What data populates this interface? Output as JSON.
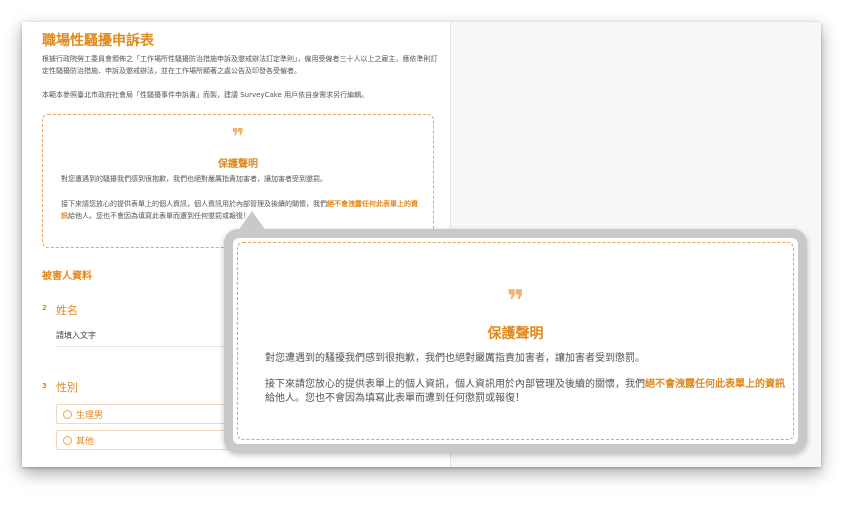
{
  "form": {
    "title": "職場性騷擾申訴表",
    "intro_1": "根據行政院勞工委員會頒佈之「工作場所性騷擾防治措施申訴及懲戒辦法訂定準則」，僱用受僱者三十人以上之雇主，應依準則訂定性騷擾防治措施、申訴及懲戒辦法，並在工作場所顯著之處公告及印發各受僱者。",
    "intro_2": "本範本參照臺北市政府社會局「性騷擾事件申訴書」而製，建議 SurveyCake 用戶依自身需求另行編輯。"
  },
  "statement": {
    "quote_glyph": "❞",
    "title": "保護聲明",
    "line_1": "對您遭遇到的騷擾我們感到很抱歉，我們也絕對嚴厲指責加害者，讓加害者受到懲罰。",
    "line_2_pre": "接下來請您放心的提供表單上的個人資訊，個人資訊用於內部管理及後續的關懷，我們",
    "line_2_highlight": "絕不會洩露任何此表單上的資訊",
    "line_2_post": "給他人。您也不會因為填寫此表單而遭到任何懲罰或報復！"
  },
  "section": {
    "title": "被害人資料"
  },
  "questions": [
    {
      "number": "2",
      "label": "姓名",
      "placeholder": "請填入文字"
    },
    {
      "number": "3",
      "label": "性別",
      "options": [
        "生理男",
        "其他"
      ]
    }
  ],
  "colors": {
    "accent": "#e08a1e",
    "accent_light": "#f0b46e",
    "dashed_border": "#e9a55a",
    "callout_frame": "#c9c9c9",
    "body_text": "#555555"
  }
}
